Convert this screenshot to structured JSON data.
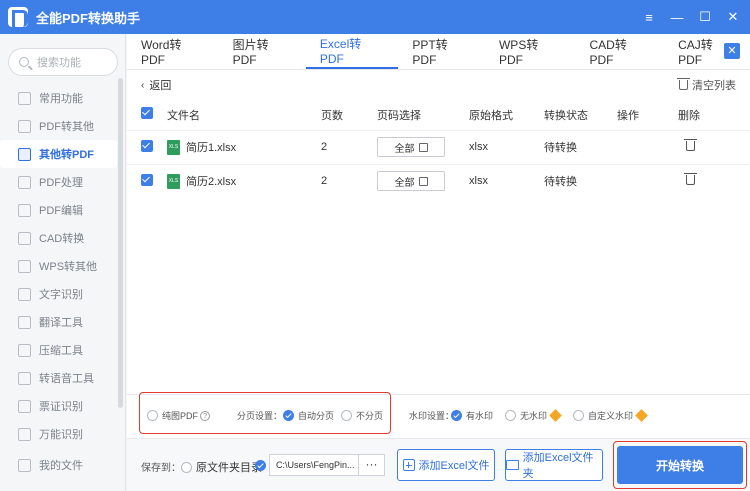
{
  "app": {
    "title": "全能PDF转换助手"
  },
  "window_controls": {
    "menu": "≡",
    "minimize": "—",
    "maximize": "☐",
    "close": "✕"
  },
  "sidebar": {
    "search_placeholder": "搜索功能",
    "items": [
      {
        "label": "常用功能"
      },
      {
        "label": "PDF转其他"
      },
      {
        "label": "其他转PDF",
        "active": true
      },
      {
        "label": "PDF处理"
      },
      {
        "label": "PDF编辑"
      },
      {
        "label": "CAD转换"
      },
      {
        "label": "WPS转其他"
      },
      {
        "label": "文字识别"
      },
      {
        "label": "翻译工具"
      },
      {
        "label": "压缩工具"
      },
      {
        "label": "转语音工具"
      },
      {
        "label": "票证识别"
      },
      {
        "label": "万能识别"
      }
    ],
    "my_files": "我的文件"
  },
  "tabs": {
    "items": [
      {
        "label": "Word转PDF"
      },
      {
        "label": "图片转PDF"
      },
      {
        "label": "Excel转PDF",
        "active": true
      },
      {
        "label": "PPT转PDF"
      },
      {
        "label": "WPS转PDF"
      },
      {
        "label": "CAD转PDF"
      },
      {
        "label": "CAJ转PDF"
      }
    ],
    "close": "✕"
  },
  "toolbar": {
    "back_label": "返回",
    "clear_label": "清空列表"
  },
  "table": {
    "headers": {
      "filename": "文件名",
      "pages": "页数",
      "page_select": "页码选择",
      "format": "原始格式",
      "status": "转换状态",
      "action": "操作",
      "delete": "删除"
    },
    "rows": [
      {
        "filename": "简历1.xlsx",
        "pages": "2",
        "page_select": "全部",
        "format": "xlsx",
        "status": "待转换",
        "icon_text": "XLS"
      },
      {
        "filename": "简历2.xlsx",
        "pages": "2",
        "page_select": "全部",
        "format": "xlsx",
        "status": "待转换",
        "icon_text": "XLS"
      }
    ]
  },
  "options": {
    "pure_pdf": "纯图PDF",
    "help": "?",
    "paging_label": "分页设置：",
    "auto_paging": "自动分页",
    "no_paging": "不分页",
    "watermark_label": "水印设置：",
    "has_watermark": "有水印",
    "no_watermark": "无水印",
    "custom_watermark": "自定义水印"
  },
  "bottom": {
    "save_to": "保存到：",
    "original_dir": "原文件夹目录",
    "path": "C:\\Users\\FengPin...",
    "path_more": "···",
    "add_file": "添加Excel文件",
    "add_folder": "添加Excel文件夹",
    "start": "开始转换"
  },
  "colors": {
    "accent": "#3d7fe6",
    "highlight": "#e23a2e",
    "file_icon": "#2e9c5b",
    "premium": "#f5a623"
  }
}
